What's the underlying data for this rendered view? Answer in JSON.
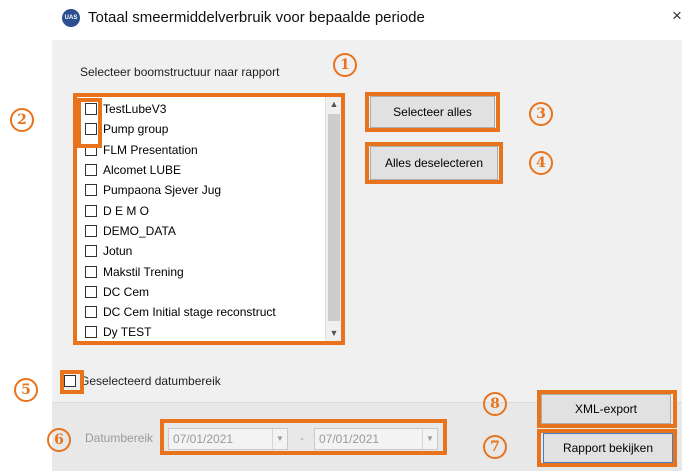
{
  "window": {
    "title": "Totaal smeermiddelverbruik voor bepaalde periode",
    "app_icon_text": "UAS",
    "close_glyph": "×"
  },
  "tree": {
    "label": "Selecteer boomstructuur naar rapport",
    "items": [
      {
        "label": "TestLubeV3",
        "checked": false
      },
      {
        "label": "Pump group",
        "checked": false
      },
      {
        "label": "FLM Presentation",
        "checked": false
      },
      {
        "label": "Alcomet LUBE",
        "checked": false
      },
      {
        "label": "Pumpaona Sjever Jug",
        "checked": false
      },
      {
        "label": "D E M O",
        "checked": false
      },
      {
        "label": "DEMO_DATA",
        "checked": false
      },
      {
        "label": "Jotun",
        "checked": false
      },
      {
        "label": "Makstil Trening",
        "checked": false
      },
      {
        "label": "DC Cem",
        "checked": false
      },
      {
        "label": "DC Cem Initial stage reconstruct",
        "checked": false
      },
      {
        "label": "Dy TEST",
        "checked": false
      }
    ]
  },
  "buttons": {
    "select_all": "Selecteer alles",
    "deselect_all": "Alles deselecteren",
    "xml_export": "XML-export",
    "view_report": "Rapport bekijken"
  },
  "date_range": {
    "checkbox_label": "Geselecteerd datumbereik",
    "checked": false,
    "label": "Datumbereik",
    "start": "07/01/2021",
    "separator": "-",
    "end": "07/01/2021"
  },
  "annotations": {
    "color": "#e8731c",
    "badges": [
      "1",
      "2",
      "3",
      "4",
      "5",
      "6",
      "7",
      "8"
    ]
  },
  "icons": [
    "app-logo-icon",
    "close-icon",
    "scroll-up-arrow-icon",
    "scroll-down-arrow-icon",
    "dropdown-arrow-icon"
  ]
}
